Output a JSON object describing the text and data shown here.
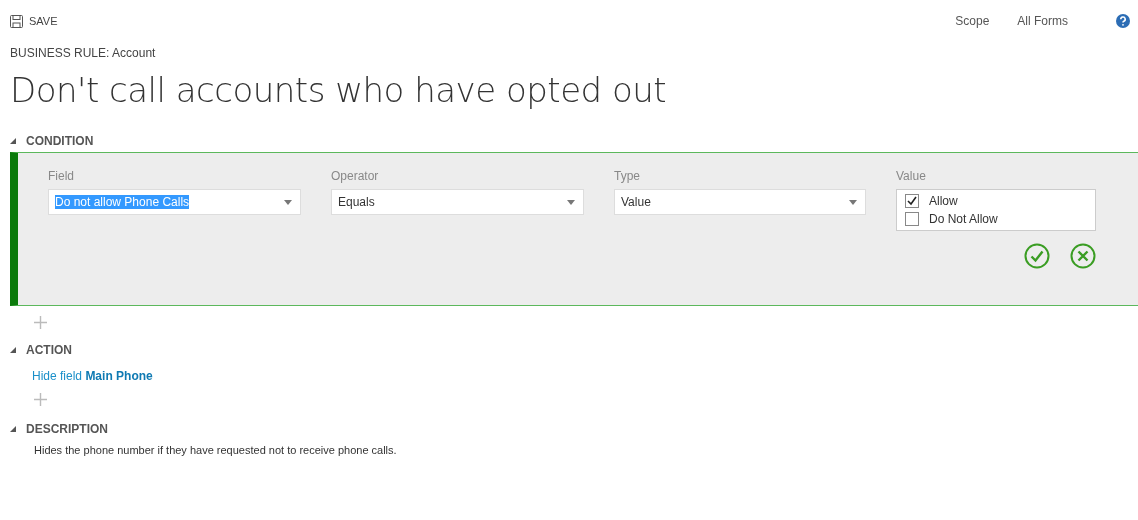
{
  "toolbar": {
    "save_label": "SAVE",
    "scope_label": "Scope",
    "scope_value": "All Forms"
  },
  "breadcrumb": "BUSINESS RULE: Account",
  "title": "Don't call accounts who have opted out",
  "condition": {
    "heading": "CONDITION",
    "dropdowns": [
      {
        "label": "Field",
        "value": "Do not allow Phone Calls",
        "text_selected": true
      },
      {
        "label": "Operator",
        "value": "Equals",
        "text_selected": false
      },
      {
        "label": "Type",
        "value": "Value",
        "text_selected": false
      }
    ],
    "value_label": "Value",
    "options": [
      {
        "label": "Allow",
        "checked": true
      },
      {
        "label": "Do Not Allow",
        "checked": false
      }
    ]
  },
  "action": {
    "heading": "ACTION",
    "items": [
      "Hide field **Main Phone**"
    ]
  },
  "description": {
    "heading": "DESCRIPTION",
    "text": "Hides the phone number if they have requested not to receive phone calls."
  }
}
